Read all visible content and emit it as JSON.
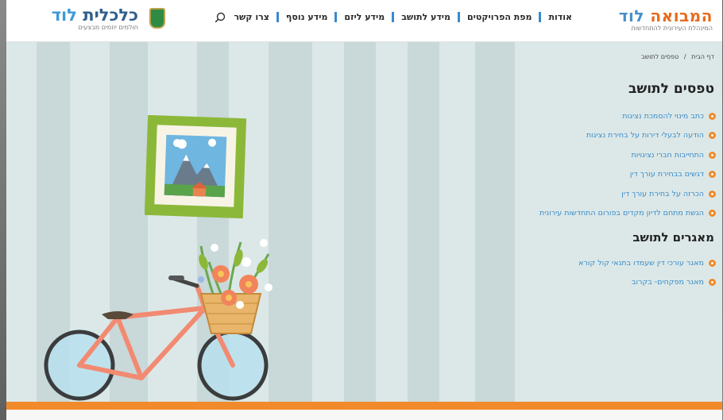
{
  "header": {
    "logo_main_title": "המבואה",
    "logo_main_lod": "לוד",
    "logo_main_tagline": "המינהלת העירונית להתחדשות",
    "nav": [
      "אודות",
      "מפת הפרויקטים",
      "מידע לתושב",
      "מידע ליזם",
      "מידע נוסף",
      "צרו קשר"
    ],
    "logo_secondary_title": "כלכלית",
    "logo_secondary_lod": "לוד",
    "logo_secondary_tagline": "חולמים יוזמים מבצעים"
  },
  "breadcrumb": {
    "home": "דף הבית",
    "separator": "/",
    "current": "טפסים לתושב"
  },
  "forms_section": {
    "title": "טפסים לתושב",
    "items": [
      "כתב מינוי להסמכת נציגות",
      "הודעה לבעלי דירות על בחירת נציגות",
      "התחייבות חברי נציגויות",
      "דגשים בבחירת עורך דין",
      "הכרזה על בחירת עורך דין",
      "הגשת מתחם לדיון מקדים בפורום התחדשות עירונית"
    ]
  },
  "databases_section": {
    "title": "מאגרים לתושב",
    "items": [
      "מאגר עורכי דין שעמדו בתנאי קול קורא",
      "מאגר מפקחים- בקרוב"
    ]
  },
  "icons": {
    "search": "search-icon",
    "emblem": "city-emblem-icon"
  },
  "colors": {
    "accent_orange": "#f08a2a",
    "link_blue": "#3a8cc8",
    "nav_separator": "#3a8ad0",
    "background": "#dce8e8"
  }
}
